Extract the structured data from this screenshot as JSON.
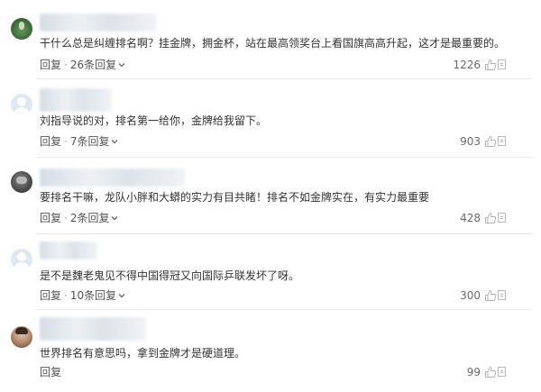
{
  "comments": [
    {
      "text": "干什么总是纠缠排名啊？挂金牌，拥金杯，站在最高领奖台上看国旗高高升起，这才是最重要的。",
      "reply_label": "回复",
      "sub_replies": "26条回复",
      "likes": "1226",
      "avatar": "green-avatar"
    },
    {
      "text": "刘指导说的对，排名第一给你，金牌给我留下。",
      "reply_label": "回复",
      "sub_replies": "7条回复",
      "likes": "903",
      "avatar": "default-avatar"
    },
    {
      "text": "要排名干嘛，龙队小胖和大蟒的实力有目共睹！排名不如金牌实在，有实力最重要",
      "reply_label": "回复",
      "sub_replies": "2条回复",
      "likes": "428",
      "avatar": "dark-avatar"
    },
    {
      "text": "是不是魏老鬼见不得中国得冠又向国际乒联发坏了呀。",
      "reply_label": "回复",
      "sub_replies": "10条回复",
      "likes": "300",
      "avatar": "default-avatar"
    },
    {
      "text": "世界排名有意思吗，拿到金牌才是硬道理。",
      "reply_label": "回复",
      "likes": "99",
      "avatar": "person-avatar"
    }
  ],
  "icons": {
    "like": "thumbs-up-icon",
    "report": "report-icon",
    "expand": "chevron-down-icon"
  },
  "colors": {
    "text": "#333333",
    "meta": "#555555",
    "divider": "#e8e8e8"
  }
}
